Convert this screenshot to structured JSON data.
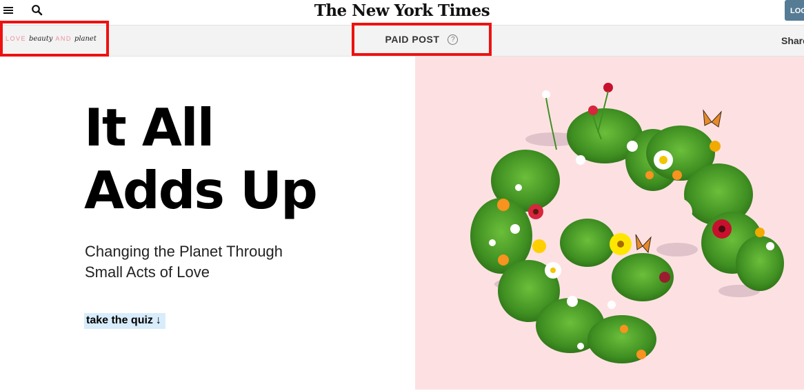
{
  "header": {
    "logo_text": "The New York Times",
    "login_label": "LOG"
  },
  "sponsor": {
    "word_love": "LOVE",
    "word_beauty": "beauty",
    "word_and": "AND",
    "word_planet": "planet",
    "paid_post_label": "PAID POST",
    "help_glyph": "?",
    "share_label": "Share"
  },
  "hero": {
    "title_line1": "It All",
    "title_line2": "Adds Up",
    "subtitle_line1": "Changing the Planet Through",
    "subtitle_line2": "Small Acts of Love",
    "quiz_label": "take the quiz",
    "quiz_arrow": "↓"
  },
  "colors": {
    "image_background": "#fde1e2",
    "highlight_box": "#ee1111",
    "quiz_highlight": "#d8ecfb",
    "login_button": "#567b95",
    "sponsor_pink": "#ee8d9d"
  },
  "icons": [
    "menu-icon",
    "search-icon",
    "help-icon",
    "down-arrow-icon"
  ]
}
